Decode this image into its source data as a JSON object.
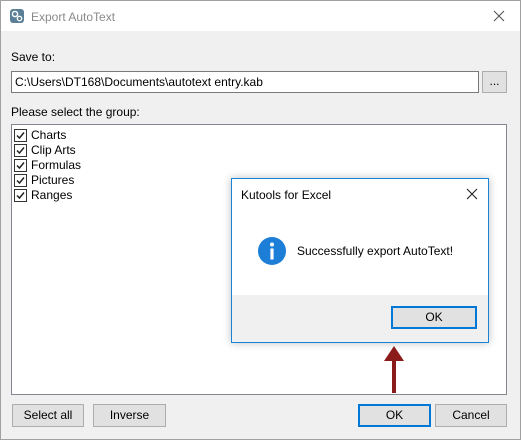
{
  "window": {
    "title": "Export AutoText",
    "app_icon": "kutools-gear-icon",
    "close_icon": "close-icon"
  },
  "save_to": {
    "label": "Save to:",
    "path": "C:\\Users\\DT168\\Documents\\autotext entry.kab",
    "browse_label": "..."
  },
  "group": {
    "label": "Please select the group:",
    "items": [
      {
        "label": "Charts",
        "checked": true
      },
      {
        "label": "Clip Arts",
        "checked": true
      },
      {
        "label": "Formulas",
        "checked": true
      },
      {
        "label": "Pictures",
        "checked": true
      },
      {
        "label": "Ranges",
        "checked": true
      }
    ]
  },
  "buttons": {
    "select_all": "Select all",
    "inverse": "Inverse",
    "ok": "OK",
    "cancel": "Cancel"
  },
  "message_box": {
    "title": "Kutools for Excel",
    "message": "Successfully export AutoText!",
    "icon": "info-icon",
    "ok": "OK",
    "close_icon": "close-icon"
  },
  "annotation": {
    "arrow_color": "#8b1a1a",
    "icon": "arrow-up-icon"
  },
  "colors": {
    "accent": "#0078d7",
    "info_icon": "#1c7ed6",
    "window_bg": "#f0f0f0"
  }
}
